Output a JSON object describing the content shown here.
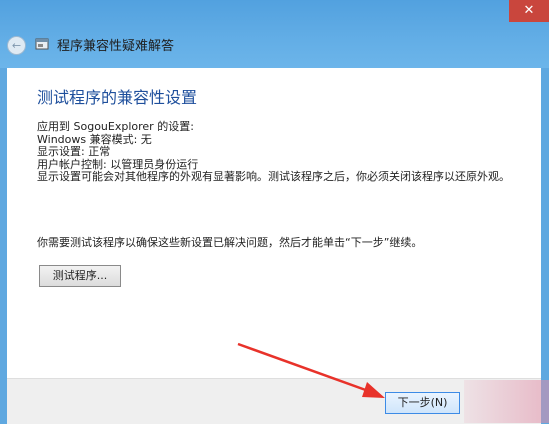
{
  "window": {
    "title": "程序兼容性疑难解答",
    "close_label": "✕"
  },
  "content": {
    "heading": "测试程序的兼容性设置",
    "info_lines": [
      "应用到 SogouExplorer 的设置:",
      "Windows 兼容模式: 无",
      "显示设置: 正常",
      "用户帐户控制: 以管理员身份运行",
      "显示设置可能会对其他程序的外观有显著影响。测试该程序之后，你必须关闭该程序以还原外观。"
    ],
    "prompt": "你需要测试该程序以确保这些新设置已解决问题，然后才能单击“下一步”继续。",
    "test_button_label": "测试程序..."
  },
  "footer": {
    "next_button_label": "下一步(N)"
  },
  "colors": {
    "frame": "#5fa8e0",
    "heading": "#1e4f9c",
    "close": "#c9463d",
    "arrow": "#e8322a"
  },
  "icons": {
    "back": "arrow-left-icon",
    "wizard": "troubleshooter-icon",
    "close": "close-icon"
  }
}
